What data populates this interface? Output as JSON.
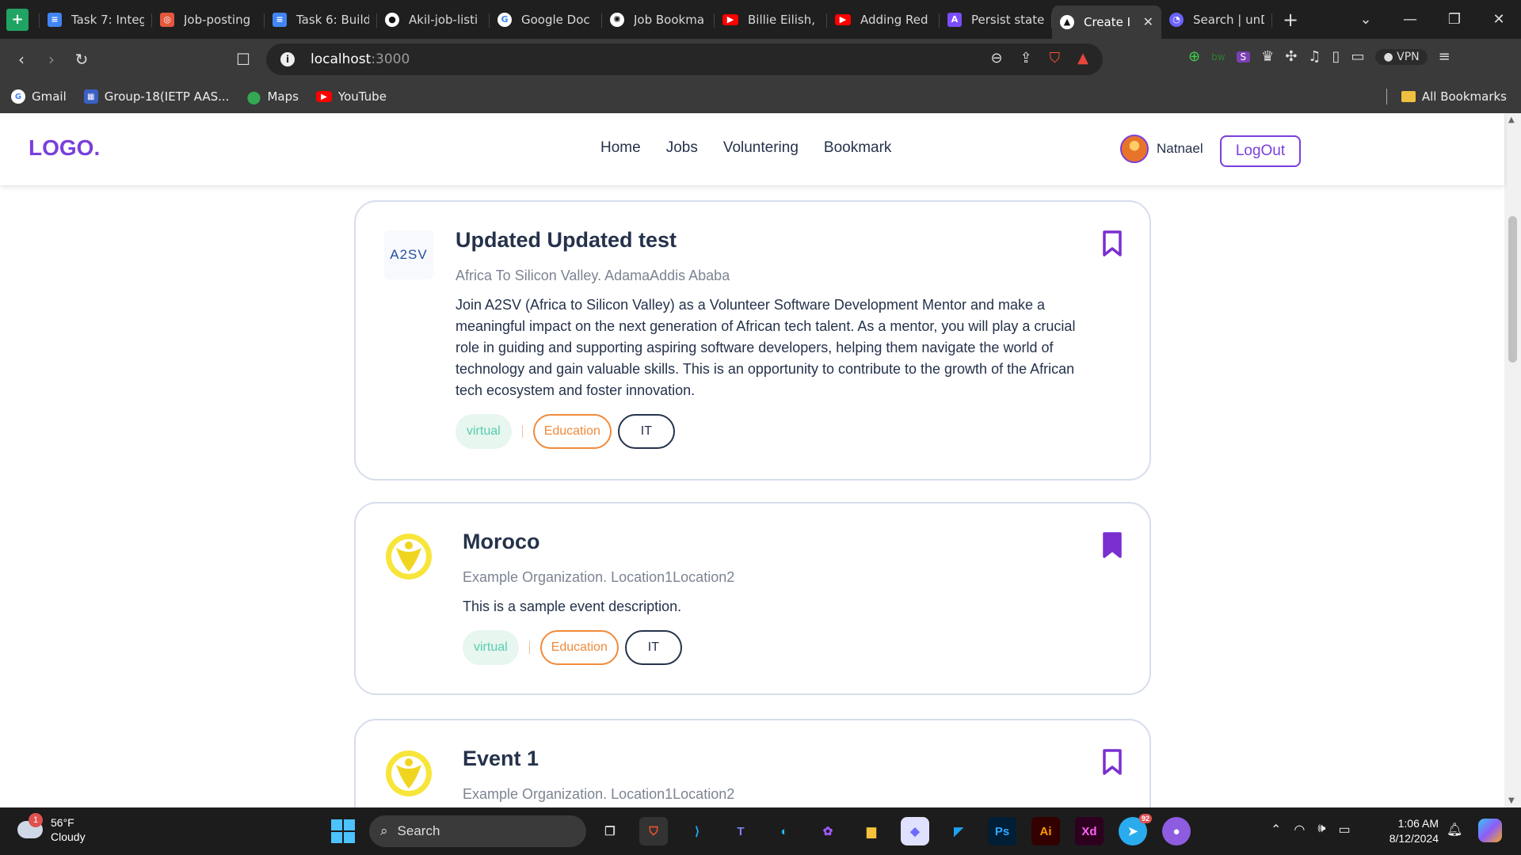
{
  "browser": {
    "tabs": [
      {
        "title": "Task 7: Integ",
        "icon": "google-sheets-icon",
        "color": "#1fa463"
      },
      {
        "title": "Job-posting",
        "icon": "figma-slides-icon",
        "color": "#e4573d"
      },
      {
        "title": "Task 6: Build",
        "icon": "google-docs-icon",
        "color": "#4285f4"
      },
      {
        "title": "Akil-job-listi",
        "icon": "github-icon",
        "color": "#ffffff"
      },
      {
        "title": "Google Doc",
        "icon": "google-icon",
        "color": "#ffffff"
      },
      {
        "title": "Job Bookma",
        "icon": "chatgpt-icon",
        "color": "#ffffff"
      },
      {
        "title": "Billie Eilish, I",
        "icon": "youtube-icon",
        "color": "#ff0000"
      },
      {
        "title": "Adding Red",
        "icon": "youtube-icon",
        "color": "#ff0000"
      },
      {
        "title": "Persist state",
        "icon": "redux-icon",
        "color": "#7c4dff"
      },
      {
        "title": "Create I",
        "icon": "vercel-icon",
        "color": "#ffffff",
        "active": true
      },
      {
        "title": "Search | unD",
        "icon": "undraw-icon",
        "color": "#6c63ff"
      }
    ],
    "url_host": "localhost",
    "url_port": ":3000",
    "bookmarks": [
      {
        "label": "Gmail",
        "icon": "google-icon"
      },
      {
        "label": "Group-18(IETP AAS...",
        "icon": "classroom-icon"
      },
      {
        "label": "Maps",
        "icon": "maps-pin-icon"
      },
      {
        "label": "YouTube",
        "icon": "youtube-icon"
      }
    ],
    "all_bookmarks": "All Bookmarks",
    "vpn": "VPN"
  },
  "header": {
    "logo": "LOGO.",
    "nav": [
      "Home",
      "Jobs",
      "Voluntering",
      "Bookmark"
    ],
    "username": "Natnael",
    "logout": "LogOut"
  },
  "cards": [
    {
      "title": "Updated Updated test",
      "org": "Africa To Silicon Valley. AdamaAddis Ababa",
      "description": "Join A2SV (Africa to Silicon Valley) as a Volunteer Software Development Mentor and make a meaningful impact on the next generation of African tech talent. As a mentor, you will play a crucial role in guiding and supporting aspiring software developers, helping them navigate the world of technology and gain valuable skills. This is an opportunity to contribute to the growth of the African tech ecosystem and foster innovation.",
      "logo_text": "A2SV",
      "bookmarked": false,
      "tags": {
        "mode": "virtual",
        "category": "Education",
        "field": "IT"
      }
    },
    {
      "title": "Moroco",
      "org": "Example Organization. Location1Location2",
      "description": "This is a sample event description.",
      "bookmarked": true,
      "tags": {
        "mode": "virtual",
        "category": "Education",
        "field": "IT"
      }
    },
    {
      "title": "Event 1",
      "org": "Example Organization. Location1Location2",
      "bookmarked": false
    }
  ],
  "taskbar": {
    "temperature": "56°F",
    "condition": "Cloudy",
    "weather_badge": "1",
    "search": "Search",
    "apps": [
      {
        "icon": "task-view-icon",
        "label": "",
        "color": "#cfcfcf"
      },
      {
        "icon": "brave-icon",
        "label": "",
        "color": "#fb542b"
      },
      {
        "icon": "vscode-icon",
        "label": "",
        "color": "#23a9f2"
      },
      {
        "icon": "teams-icon",
        "label": "",
        "color": "#6264a7"
      },
      {
        "icon": "edge-icon",
        "label": "",
        "color": "#1ebbee"
      },
      {
        "icon": "figma-icon",
        "label": "",
        "color": "#a259ff"
      },
      {
        "icon": "file-explorer-icon",
        "label": "",
        "color": "#f5c33b"
      },
      {
        "icon": "notion-icon",
        "label": "",
        "color": "#e0e0ff"
      },
      {
        "icon": "framer-icon",
        "label": "",
        "color": "#1da1f2"
      },
      {
        "icon": "photoshop-icon",
        "label": "Ps",
        "color": "#31a8ff"
      },
      {
        "icon": "illustrator-icon",
        "label": "Ai",
        "color": "#ff9a00"
      },
      {
        "icon": "xd-icon",
        "label": "Xd",
        "color": "#ff61f6"
      },
      {
        "icon": "telegram-icon",
        "label": "",
        "color": "#2aabee",
        "badge": "92"
      },
      {
        "icon": "github-desktop-icon",
        "label": "",
        "color": "#8e5ce0"
      }
    ],
    "time": "1:06 AM",
    "date": "8/12/2024"
  }
}
